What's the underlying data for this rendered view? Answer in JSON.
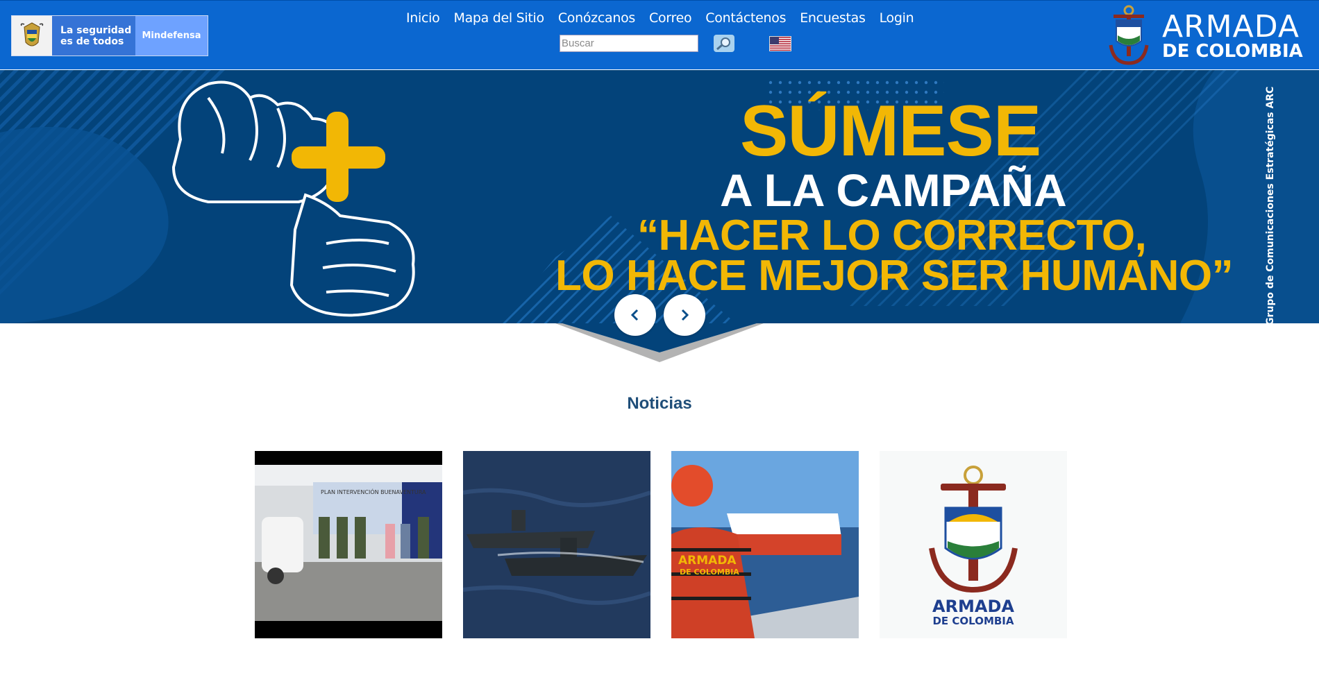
{
  "header": {
    "gov_slogan_line1": "La seguridad",
    "gov_slogan_line2": "es de todos",
    "ministry": "Mindefensa",
    "nav": [
      "Inicio",
      "Mapa del Sitio",
      "Conózcanos",
      "Correo",
      "Contáctenos",
      "Encuestas",
      "Login"
    ],
    "search_placeholder": "Buscar",
    "brand_line1": "ARMADA",
    "brand_line2": "DE COLOMBIA",
    "colors": {
      "bar": "#0b67d0",
      "slogan_bg": "#3573d6",
      "ministry_bg": "#6ea2ff"
    }
  },
  "hero": {
    "line1": "SÚMESE",
    "line2": "A LA CAMPAÑA",
    "line3": "“HACER LO CORRECTO,",
    "line4": "LO HACE MEJOR SER HUMANO”",
    "vertical_credit": "Grupo de Comunicaciones Estratégicas ARC",
    "colors": {
      "bg": "#03437a",
      "accent": "#f2b705"
    },
    "prev_icon": "chevron-left-icon",
    "next_icon": "chevron-right-icon"
  },
  "news": {
    "title": "Noticias",
    "cards": [
      {
        "banner": "PLAN INTERVENCIÓN BUENAVENTURA"
      },
      {
        "icon": "ship-photo"
      },
      {
        "vest_line1": "ARMADA",
        "vest_line2": "DE COLOMBIA"
      },
      {
        "logo_line1": "ARMADA",
        "logo_line2": "DE COLOMBIA"
      }
    ]
  }
}
